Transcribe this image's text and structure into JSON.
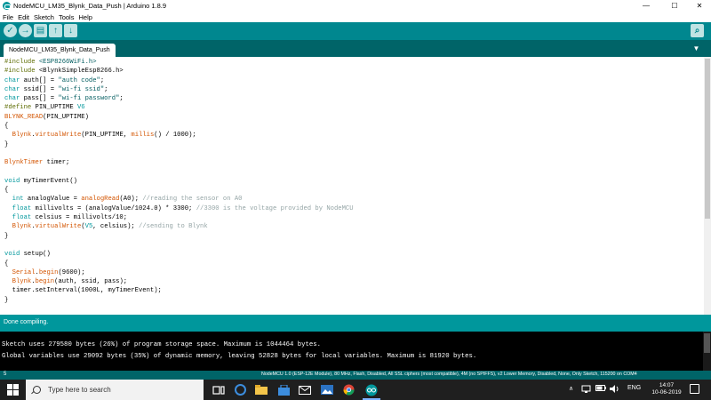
{
  "window": {
    "title": "NodeMCU_LM35_Blynk_Data_Push | Arduino 1.8.9",
    "minimize": "—",
    "maximize": "☐",
    "close": "✕"
  },
  "menu": [
    "File",
    "Edit",
    "Sketch",
    "Tools",
    "Help"
  ],
  "toolbar": {
    "verify": "✓",
    "upload": "→",
    "new": "▤",
    "open": "↑",
    "save": "↓",
    "serial_monitor": "⌕"
  },
  "tab": {
    "label": "NodeMCU_LM35_Blynk_Data_Push",
    "menu_glyph": "▼"
  },
  "code": [
    [
      [
        "pp",
        "#include "
      ],
      [
        "str",
        "<ESP8266WiFi.h>"
      ]
    ],
    [
      [
        "pp",
        "#include "
      ],
      [
        "",
        "<BlynkSimpleEsp8266.h>"
      ]
    ],
    [
      [
        "kw",
        "char"
      ],
      [
        "",
        " auth[] = "
      ],
      [
        "str",
        "\"auth code\""
      ],
      [
        "",
        ";"
      ]
    ],
    [
      [
        "kw",
        "char"
      ],
      [
        "",
        " ssid[] = "
      ],
      [
        "str",
        "\"wi-fi ssid\""
      ],
      [
        "",
        ";"
      ]
    ],
    [
      [
        "kw",
        "char"
      ],
      [
        "",
        " pass[] = "
      ],
      [
        "str",
        "\"wi-fi password\""
      ],
      [
        "",
        ";"
      ]
    ],
    [
      [
        "pp",
        "#define"
      ],
      [
        "",
        " PIN_UPTIME "
      ],
      [
        "kw",
        "V6"
      ]
    ],
    [
      [
        "fn",
        "BLYNK_READ"
      ],
      [
        "",
        "(PIN_UPTIME)"
      ]
    ],
    [
      [
        "",
        "{"
      ]
    ],
    [
      [
        "",
        "  "
      ],
      [
        "fn",
        "Blynk"
      ],
      [
        "",
        "."
      ],
      [
        "fn",
        "virtualWrite"
      ],
      [
        "",
        "(PIN_UPTIME, "
      ],
      [
        "fn",
        "millis"
      ],
      [
        "",
        "() / 1000);"
      ]
    ],
    [
      [
        "",
        "}"
      ]
    ],
    [
      [
        "",
        ""
      ]
    ],
    [
      [
        "fn",
        "BlynkTimer"
      ],
      [
        "",
        " timer;"
      ]
    ],
    [
      [
        "",
        ""
      ]
    ],
    [
      [
        "kw",
        "void"
      ],
      [
        "",
        " myTimerEvent()"
      ]
    ],
    [
      [
        "",
        "{"
      ]
    ],
    [
      [
        "",
        "  "
      ],
      [
        "kw",
        "int"
      ],
      [
        "",
        " analogValue = "
      ],
      [
        "fn",
        "analogRead"
      ],
      [
        "",
        "(A0); "
      ],
      [
        "cm",
        "//reading the sensor on A0"
      ]
    ],
    [
      [
        "",
        "  "
      ],
      [
        "kw",
        "float"
      ],
      [
        "",
        " millivolts = (analogValue/1024.0) * 3300; "
      ],
      [
        "cm",
        "//3300 is the voltage provided by NodeMCU"
      ]
    ],
    [
      [
        "",
        "  "
      ],
      [
        "kw",
        "float"
      ],
      [
        "",
        " celsius = millivolts/10;"
      ]
    ],
    [
      [
        "",
        "  "
      ],
      [
        "fn",
        "Blynk"
      ],
      [
        "",
        "."
      ],
      [
        "fn",
        "virtualWrite"
      ],
      [
        "",
        "("
      ],
      [
        "kw",
        "V5"
      ],
      [
        "",
        ", celsius); "
      ],
      [
        "cm",
        "//sending to Blynk"
      ]
    ],
    [
      [
        "",
        "}"
      ]
    ],
    [
      [
        "",
        ""
      ]
    ],
    [
      [
        "kw",
        "void"
      ],
      [
        "",
        " setup()"
      ]
    ],
    [
      [
        "",
        "{"
      ]
    ],
    [
      [
        "",
        "  "
      ],
      [
        "fn",
        "Serial"
      ],
      [
        "",
        "."
      ],
      [
        "fn",
        "begin"
      ],
      [
        "",
        "(9600);"
      ]
    ],
    [
      [
        "",
        "  "
      ],
      [
        "fn",
        "Blynk"
      ],
      [
        "",
        "."
      ],
      [
        "fn",
        "begin"
      ],
      [
        "",
        "(auth, ssid, pass);"
      ]
    ],
    [
      [
        "",
        "  timer.setInterval(1000L, myTimerEvent);"
      ]
    ],
    [
      [
        "",
        "}"
      ]
    ]
  ],
  "status": "Done compiling.",
  "console": [
    "Sketch uses 279580 bytes (26%) of program storage space. Maximum is 1044464 bytes.",
    "Global variables use 29092 bytes (35%) of dynamic memory, leaving 52828 bytes for local variables. Maximum is 81920 bytes."
  ],
  "bottom": {
    "line_number": "5",
    "board_info": "NodeMCU 1.0 (ESP-12E Module), 80 MHz, Flash, Disabled, All SSL ciphers (most compatible), 4M (no SPIFFS), v2 Lower Memory, Disabled, None, Only Sketch, 115200 on COM4"
  },
  "taskbar": {
    "search_placeholder": "Type here to search",
    "tray_chevron": "∧",
    "language": "ENG",
    "time": "14:07",
    "date": "10-06-2019"
  }
}
